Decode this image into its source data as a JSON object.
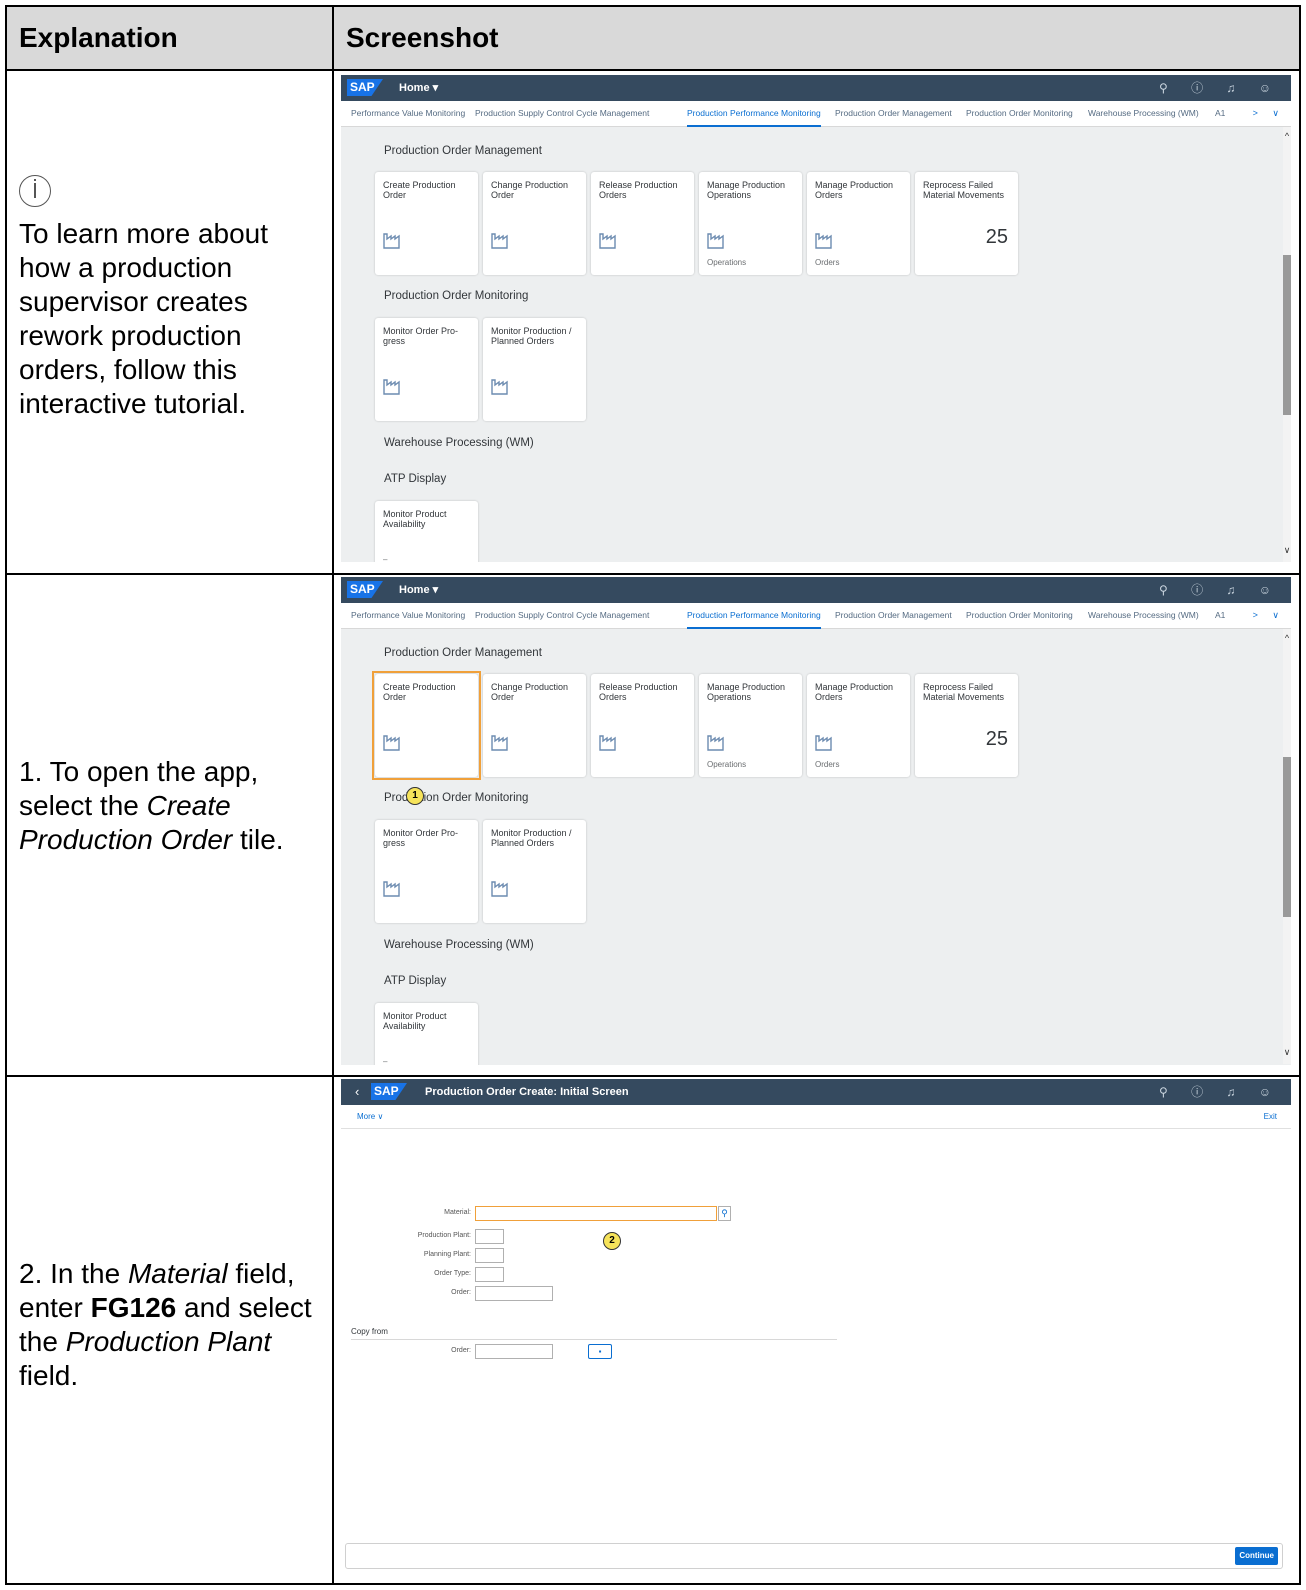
{
  "headers": {
    "explanation": "Explanation",
    "screenshot": "Screenshot"
  },
  "rows": [
    {
      "explanation": "To learn more about how a production supervisor creates rework production orders, follow this interactive tutorial."
    },
    {
      "explanation_prefix": "1. To open the app, select the ",
      "explanation_em": "Create Production Order",
      "explanation_suffix": " tile.",
      "badge": "1"
    },
    {
      "explanation_prefix": "2. In the ",
      "explanation_em": "Material",
      "explanation_mid": " field, enter ",
      "explanation_strong": "FG126",
      "explanation_mid2": " and select the ",
      "explanation_em2": "Production Plant",
      "explanation_suffix": " field.",
      "badge": "2"
    }
  ],
  "launchpad": {
    "logo": "SAP",
    "home": "Home ▾",
    "nav_tabs": [
      "Performance Value Monitoring",
      "Production Supply Control Cycle Management",
      "Production Performance Monitoring",
      "Production Order Management",
      "Production Order Monitoring",
      "Warehouse Processing (WM)",
      "A1"
    ],
    "active_tab": "Production Performance Monitoring",
    "groups": {
      "pom": "Production Order Management",
      "monitoring": "Production Order Monitoring",
      "wm": "Warehouse Processing (WM)",
      "atp": "ATP Display"
    },
    "tiles_pom": [
      {
        "title": "Create Production Order",
        "footer": ""
      },
      {
        "title": "Change Production Order",
        "footer": ""
      },
      {
        "title": "Release Production Orders",
        "footer": ""
      },
      {
        "title": "Manage Production Operations",
        "footer": "Operations"
      },
      {
        "title": "Manage Production Orders",
        "footer": "Orders"
      },
      {
        "title": "Reprocess Failed Material Movements",
        "number": "25"
      }
    ],
    "tiles_mon": [
      {
        "title": "Monitor Order Pro- gress"
      },
      {
        "title": "Monitor Production / Planned Orders"
      }
    ],
    "tile_atp": {
      "title": "Monitor Product Availability",
      "footer": "–"
    }
  },
  "form": {
    "logo": "SAP",
    "title": "Production Order Create: Initial Screen",
    "more": "More ∨",
    "exit": "Exit",
    "labels": {
      "material": "Material:",
      "prod_plant": "Production Plant:",
      "plan_plant": "Planning Plant:",
      "order_type": "Order Type:",
      "order": "Order:",
      "copy_from": "Copy from",
      "copy_order": "Order:"
    },
    "continue": "Continue"
  },
  "colors": {
    "shell": "#354a5f",
    "accent": "#0a6ed1",
    "highlight": "#f0a03a",
    "badge": "#f6e35a"
  }
}
